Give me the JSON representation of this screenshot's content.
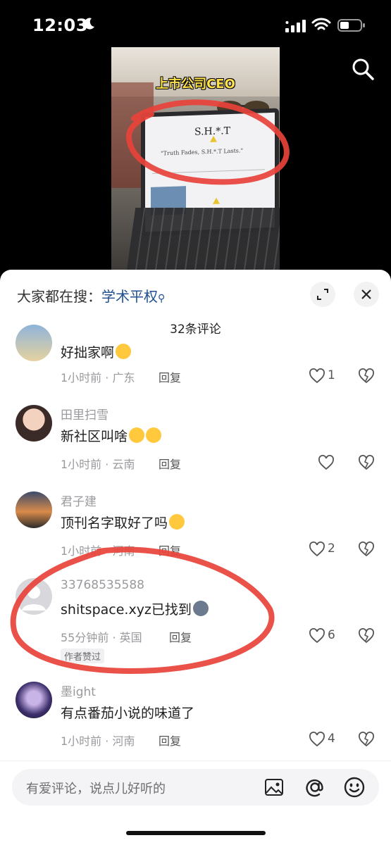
{
  "status_bar": {
    "time": "12:03"
  },
  "video": {
    "caption": "上市公司CEO",
    "screen_title": "S.H.*.T",
    "screen_tagline": "\"Truth Fades, S.H.*.T Lasts.\""
  },
  "sheet": {
    "hot_search_prefix": "大家都在搜：",
    "hot_search_keyword": "学术平权",
    "hot_search_mag": "⚲",
    "comment_count": "32条评论"
  },
  "comments": [
    {
      "username": "",
      "text": "好拙家啊",
      "time_location": "1小时前 · 广东",
      "reply": "回复",
      "likes": "1"
    },
    {
      "username": "田里扫雪",
      "text": "新社区叫啥",
      "time_location": "1小时前 · 云南",
      "reply": "回复",
      "likes": ""
    },
    {
      "username": "君子建",
      "text": "顶刊名字取好了吗",
      "time_location": "1小时前 · 河南",
      "reply": "回复",
      "likes": "2"
    },
    {
      "username": "33768535588",
      "text": "shitspace.xyz已找到",
      "time_location": "55分钟前 · 英国",
      "reply": "回复",
      "likes": "6",
      "badge": "作者赞过"
    },
    {
      "username": "墨ight",
      "text": "有点番茄小说的味道了",
      "time_location": "1小时前 · 河南",
      "reply": "回复",
      "likes": "4"
    }
  ],
  "input": {
    "placeholder": "有爱评论，说点儿好听的"
  },
  "colors": {
    "accent_link": "#1f4f91",
    "annotation_red": "#e8423a",
    "caption_yellow": "#ffe14a"
  }
}
